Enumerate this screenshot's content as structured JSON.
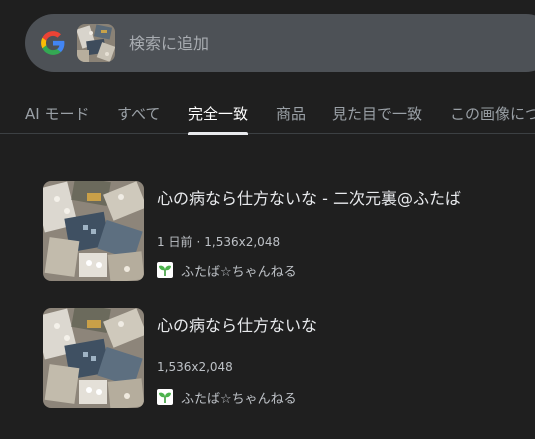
{
  "search": {
    "placeholder": "検索に追加",
    "logo_icon": "google-g-icon"
  },
  "tabs": [
    {
      "label": "AI モード",
      "active": false
    },
    {
      "label": "すべて",
      "active": false
    },
    {
      "label": "完全一致",
      "active": true
    },
    {
      "label": "商品",
      "active": false
    },
    {
      "label": "見た目で一致",
      "active": false
    },
    {
      "label": "この画像につ",
      "active": false
    }
  ],
  "results": [
    {
      "title": "心の病なら仕方ないな - 二次元裏@ふたば",
      "time": "1 日前",
      "separator": "·",
      "dimensions": "1,536x2,048",
      "source": "ふたば☆ちゃんねる",
      "source_icon": "sprout-icon"
    },
    {
      "title": "心の病なら仕方ないな",
      "dimensions": "1,536x2,048",
      "source": "ふたば☆ちゃんねる",
      "source_icon": "sprout-icon"
    }
  ],
  "colors": {
    "background": "#1f1f1f",
    "searchbar": "#4d5156",
    "text": "#e8eaed",
    "muted": "#9aa0a6"
  }
}
